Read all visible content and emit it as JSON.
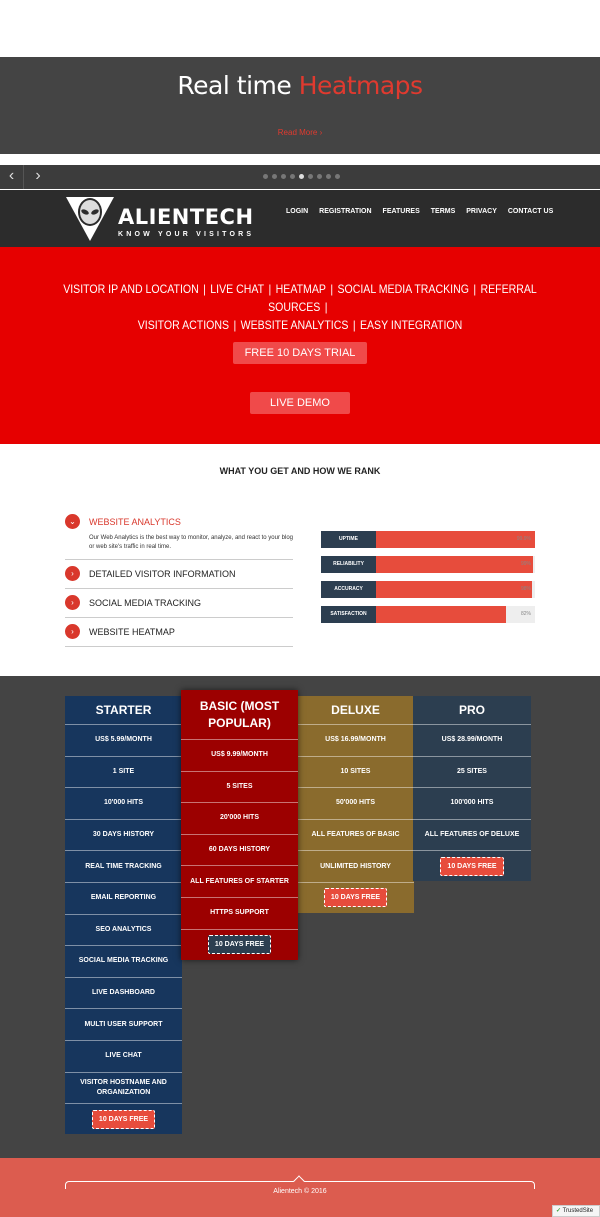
{
  "hero": {
    "title_plain": "Real time",
    "title_accent": "Heatmaps",
    "link": "Read More ›",
    "dots_count": 9,
    "active_dot": 4
  },
  "header": {
    "logo_text": "ALIENTECH",
    "logo_tagline": "KNOW YOUR VISITORS",
    "nav": [
      "LOGIN",
      "REGISTRATION",
      "FEATURES",
      "TERMS",
      "PRIVACY",
      "CONTACT US"
    ]
  },
  "features": {
    "line1": [
      "VISITOR IP AND LOCATION",
      "LIVE CHAT",
      "HEATMAP",
      "SOCIAL MEDIA TRACKING",
      "REFERRAL SOURCES"
    ],
    "line2": [
      "VISITOR ACTIONS",
      "WEBSITE ANALYTICS",
      "EASY INTEGRATION"
    ],
    "trial_button": "FREE 10 DAYS TRIAL",
    "demo_button": "LIVE DEMO"
  },
  "rank": {
    "title": "WHAT YOU GET AND HOW WE RANK",
    "accordion": [
      {
        "label": "WEBSITE ANALYTICS",
        "open": true,
        "body": "Our Web Analytics is the best way to monitor, analyze, and react to your blog or web site's traffic in real time."
      },
      {
        "label": "DETAILED VISITOR INFORMATION",
        "open": false
      },
      {
        "label": "SOCIAL MEDIA TRACKING",
        "open": false
      },
      {
        "label": "WEBSITE HEATMAP",
        "open": false
      }
    ],
    "bars": [
      {
        "label": "UPTIME",
        "value": 99.9,
        "text": "99.9%"
      },
      {
        "label": "RELIABILITY",
        "value": 99,
        "text": "99%"
      },
      {
        "label": "ACCURACY",
        "value": 98,
        "text": "98%"
      },
      {
        "label": "SATISFACTION",
        "value": 82,
        "text": "82%"
      }
    ]
  },
  "pricing": {
    "plans": [
      {
        "key": "starter",
        "name": "STARTER",
        "rows": [
          "US$ 5.99/MONTH",
          "1 SITE",
          "10'000 HITS",
          "30 DAYS HISTORY",
          "REAL TIME TRACKING",
          "EMAIL REPORTING",
          "SEO ANALYTICS",
          "SOCIAL MEDIA TRACKING",
          "LIVE DASHBOARD",
          "MULTI USER SUPPORT",
          "LIVE CHAT",
          "VISITOR HOSTNAME AND ORGANIZATION"
        ],
        "cta": "10 DAYS FREE"
      },
      {
        "key": "basic",
        "name": "BASIC (MOST POPULAR)",
        "rows": [
          "US$ 9.99/MONTH",
          "5 SITES",
          "20'000 HITS",
          "60 DAYS HISTORY",
          "ALL FEATURES OF STARTER",
          "HTTPS SUPPORT"
        ],
        "cta": "10 DAYS FREE"
      },
      {
        "key": "deluxe",
        "name": "DELUXE",
        "rows": [
          "US$ 16.99/MONTH",
          "10 SITES",
          "50'000 HITS",
          "ALL FEATURES OF BASIC",
          "UNLIMITED HISTORY"
        ],
        "cta": "10 DAYS FREE"
      },
      {
        "key": "pro",
        "name": "PRO",
        "rows": [
          "US$ 28.99/MONTH",
          "25 SITES",
          "100'000 HITS",
          "ALL FEATURES OF DELUXE"
        ],
        "cta": "10 DAYS FREE"
      }
    ]
  },
  "footer": {
    "copyright": "Alientech © 2016",
    "badge": "TrustedSite"
  }
}
